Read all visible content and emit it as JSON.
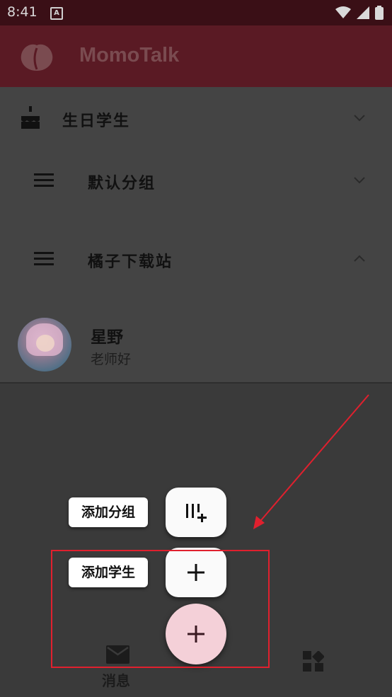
{
  "status_bar": {
    "time": "8:41",
    "notification_icon": "a-icon",
    "icons": [
      "wifi-icon",
      "signal-icon",
      "battery-icon"
    ]
  },
  "app_bar": {
    "title": "MomoTalk",
    "logo": "peach-logo-icon"
  },
  "groups": [
    {
      "icon": "cake-icon",
      "label": "生日学生",
      "expanded": false
    },
    {
      "icon": "menu-icon",
      "label": "默认分组",
      "expanded": false
    },
    {
      "icon": "menu-icon",
      "label": "橘子下载站",
      "expanded": true
    }
  ],
  "student": {
    "name": "星野",
    "message": "老师好"
  },
  "speed_dial": {
    "add_group_label": "添加分组",
    "add_group_icon": "add-column-icon",
    "add_student_label": "添加学生",
    "add_student_icon": "plus-icon",
    "main_icon": "plus-icon"
  },
  "bottom_nav": {
    "messages_label": "消息",
    "messages_icon": "mail-icon",
    "widgets_icon": "widgets-icon"
  },
  "colors": {
    "app_bar": "#5a1a24",
    "fab_main": "#f4d0d8",
    "annotation": "#e0202e"
  }
}
